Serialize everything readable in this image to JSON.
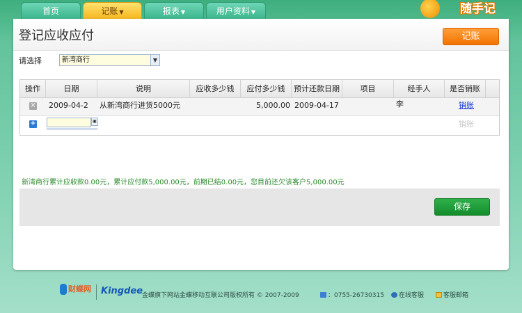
{
  "nav": {
    "tabs": [
      {
        "label": "首页",
        "has_menu": false,
        "active": false
      },
      {
        "label": "记账",
        "has_menu": true,
        "active": true
      },
      {
        "label": "报表",
        "has_menu": true,
        "active": false
      },
      {
        "label": "用户资料",
        "has_menu": true,
        "active": false
      }
    ],
    "logo_text": "随手记"
  },
  "page": {
    "title": "登记应收应付",
    "post_button": "记账"
  },
  "select": {
    "label": "请选择",
    "value": "新湾商行"
  },
  "table": {
    "columns": [
      "操作",
      "日期",
      "说明",
      "应收多少钱",
      "应付多少钱",
      "预计还款日期",
      "项目",
      "经手人",
      "是否销账"
    ],
    "rows": [
      {
        "date": "2009-04-2",
        "description": "从新湾商行进货5000元",
        "receivable": "",
        "payable": "5,000.00",
        "due_date": "2009-04-17",
        "project": "",
        "handler": "李",
        "settle": "销账"
      }
    ],
    "new_row_settle": "销账"
  },
  "summary": "新湾商行累计应收款0.00元，累计应付款5,000.00元，前期已结0.00元，您目前还欠该客户5,000.00元",
  "save_button": "保存",
  "footer": {
    "site_logo": "财蝶网",
    "brand": "Kingdee",
    "copyright": "金蝶旗下网站金蝶移动互联公司版权所有 © 2007-2009",
    "phone": "：0755-26730315",
    "online_service": "在线客服",
    "service_mail": "客服邮箱"
  },
  "colors": {
    "accent_orange": "#f27400",
    "save_green": "#138c2c",
    "summary_text": "#2d8a2d",
    "link": "#1a36d6",
    "background_green": "#4fb98c"
  }
}
